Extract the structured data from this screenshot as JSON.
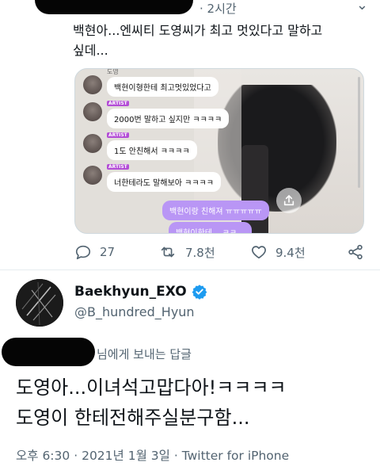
{
  "top_tweet": {
    "timestamp": "2시간",
    "text_line1": "백현아...엔씨티 도영씨가 최고 멋있다고 말하고",
    "text_line2": "싶데...",
    "media": {
      "top_partial": "도영",
      "bubbles": [
        {
          "tag": "ARTIST",
          "text": "백현이형한테 최고멋있었다고"
        },
        {
          "tag": "ARTIST",
          "text": "2000번 말하고 싶지만 ㅋㅋㅋㅋ"
        },
        {
          "tag": "ARTIST",
          "text": "1도 안친해서 ㅋㅋㅋㅋ"
        },
        {
          "tag": "ARTIST",
          "text": "너한테라도 말해보아 ㅋㅋㅋㅋ"
        }
      ],
      "purple_bubbles": [
        {
          "text": "백현이랑 친해져 ㅠㅠㅠㅠㅠ"
        },
        {
          "text": "백현이한테 ...ㅋㅋ..."
        }
      ]
    },
    "actions": {
      "replies": "27",
      "retweets": "7.8천",
      "likes": "9.4천"
    }
  },
  "reply_tweet": {
    "display_name": "Baekhyun_EXO",
    "handle": "@B_hundred_Hyun",
    "replying_to": "님에게 보내는 답글",
    "text_line1": "도영아...이녀석고맙다아!ㅋㅋㅋㅋ",
    "text_line2": "도영이 한테전해주실분구함...",
    "meta": {
      "time": "오후 6:30",
      "date": "2021년 1월 3일",
      "separator": "·",
      "source": "Twitter for iPhone"
    }
  },
  "colors": {
    "verified": "#1d9bf0",
    "muted": "#536471",
    "artist_tag": "#b34dd6",
    "purple_bubble": "#b996f5"
  }
}
